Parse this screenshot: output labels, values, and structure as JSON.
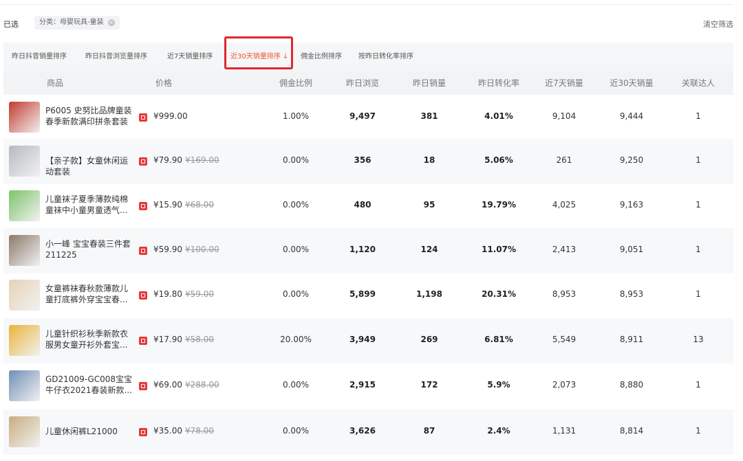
{
  "filter": {
    "label": "已选",
    "tag": "分类：母婴玩具-童装",
    "clear": "清空筛选"
  },
  "sort_tabs": [
    {
      "label": "昨日抖音销量排序"
    },
    {
      "label": "昨日抖音浏览量排序"
    },
    {
      "label": "近7天销量排序"
    },
    {
      "label": "近30天销量排序",
      "active": true
    },
    {
      "label": "佣金比例排序"
    },
    {
      "label": "按昨日转化率排序"
    }
  ],
  "columns": [
    "商品",
    "价格",
    "佣金比例",
    "昨日浏览",
    "昨日销量",
    "昨日转化率",
    "近7天销量",
    "近30天销量",
    "关联达人"
  ],
  "rows": [
    {
      "name": "P6005 史努比品牌童装春季新款满印拼条套装",
      "price": "¥999.00",
      "orig": "",
      "commission": "1.00%",
      "views": "9,497",
      "sales": "381",
      "conv": "4.01%",
      "sales7": "9,104",
      "sales30": "9,444",
      "creators": "1",
      "thumb_color": "#c43a2f"
    },
    {
      "name": "【亲子款】女童休闲运动套装",
      "price": "¥79.90",
      "orig": "¥169.00",
      "commission": "0.00%",
      "views": "356",
      "sales": "18",
      "conv": "5.06%",
      "sales7": "261",
      "sales30": "9,250",
      "creators": "1",
      "thumb_color": "#b7b9c2"
    },
    {
      "name": "儿童袜子夏季薄款纯棉童袜中小童男童透气...",
      "price": "¥15.90",
      "orig": "¥68.00",
      "commission": "0.00%",
      "views": "480",
      "sales": "95",
      "conv": "19.79%",
      "sales7": "4,025",
      "sales30": "9,163",
      "creators": "1",
      "thumb_color": "#7cc36a"
    },
    {
      "name": "小一峰 宝宝春装三件套211225",
      "price": "¥59.90",
      "orig": "¥100.00",
      "commission": "0.00%",
      "views": "1,120",
      "sales": "124",
      "conv": "11.07%",
      "sales7": "2,413",
      "sales30": "9,051",
      "creators": "1",
      "thumb_color": "#8c7a6a"
    },
    {
      "name": "女童裤袜春秋款薄款儿童打底裤外穿宝宝春...",
      "price": "¥19.80",
      "orig": "¥59.00",
      "commission": "0.00%",
      "views": "5,899",
      "sales": "1,198",
      "conv": "20.31%",
      "sales7": "8,953",
      "sales30": "8,953",
      "creators": "1",
      "thumb_color": "#e6d3b5"
    },
    {
      "name": "儿童针织衫秋季新款衣服男女童开衫外套宝...",
      "price": "¥17.90",
      "orig": "¥58.00",
      "commission": "20.00%",
      "views": "3,949",
      "sales": "269",
      "conv": "6.81%",
      "sales7": "5,549",
      "sales30": "8,911",
      "creators": "13",
      "thumb_color": "#e9b53b"
    },
    {
      "name": "GD21009-GC008宝宝牛仔衣2021春装新款...",
      "price": "¥69.00",
      "orig": "¥288.00",
      "commission": "0.00%",
      "views": "2,915",
      "sales": "172",
      "conv": "5.9%",
      "sales7": "2,073",
      "sales30": "8,880",
      "creators": "1",
      "thumb_color": "#6f8fb5"
    },
    {
      "name": "儿童休闲裤L21000",
      "price": "¥35.00",
      "orig": "¥78.00",
      "commission": "0.00%",
      "views": "3,626",
      "sales": "87",
      "conv": "2.4%",
      "sales7": "1,131",
      "sales30": "8,814",
      "creators": "1",
      "thumb_color": "#c8ad7f"
    }
  ]
}
